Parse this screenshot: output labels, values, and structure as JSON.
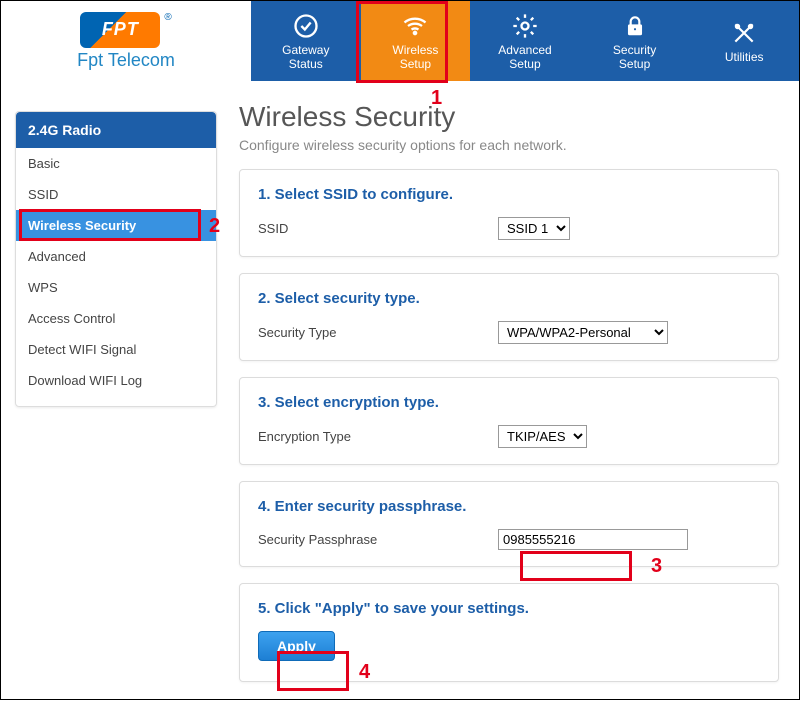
{
  "brand": {
    "mark": "FPT",
    "name": "Fpt Telecom"
  },
  "topnav": [
    {
      "label1": "Gateway",
      "label2": "Status",
      "icon": "check-circle"
    },
    {
      "label1": "Wireless",
      "label2": "Setup",
      "icon": "wifi",
      "active": true
    },
    {
      "label1": "Advanced",
      "label2": "Setup",
      "icon": "gear"
    },
    {
      "label1": "Security",
      "label2": "Setup",
      "icon": "lock"
    },
    {
      "label1": "Utilities",
      "label2": "",
      "icon": "tools"
    }
  ],
  "sidebar": {
    "header": "2.4G Radio",
    "items": [
      {
        "label": "Basic"
      },
      {
        "label": "SSID"
      },
      {
        "label": "Wireless Security",
        "active": true
      },
      {
        "label": "Advanced"
      },
      {
        "label": "WPS"
      },
      {
        "label": "Access Control"
      },
      {
        "label": "Detect WIFI Signal"
      },
      {
        "label": "Download WIFI Log"
      }
    ]
  },
  "page": {
    "title": "Wireless Security",
    "subtitle": "Configure wireless security options for each network."
  },
  "sections": {
    "s1": {
      "title": "1. Select SSID to configure.",
      "label": "SSID",
      "value": "SSID 1"
    },
    "s2": {
      "title": "2. Select security type.",
      "label": "Security Type",
      "value": "WPA/WPA2-Personal"
    },
    "s3": {
      "title": "3. Select encryption type.",
      "label": "Encryption Type",
      "value": "TKIP/AES"
    },
    "s4": {
      "title": "4. Enter security passphrase.",
      "label": "Security Passphrase",
      "value": "0985555216"
    },
    "s5": {
      "title": "5. Click \"Apply\" to save your settings.",
      "button": "Apply"
    }
  },
  "annotations": {
    "a1": "1",
    "a2": "2",
    "a3": "3",
    "a4": "4"
  }
}
